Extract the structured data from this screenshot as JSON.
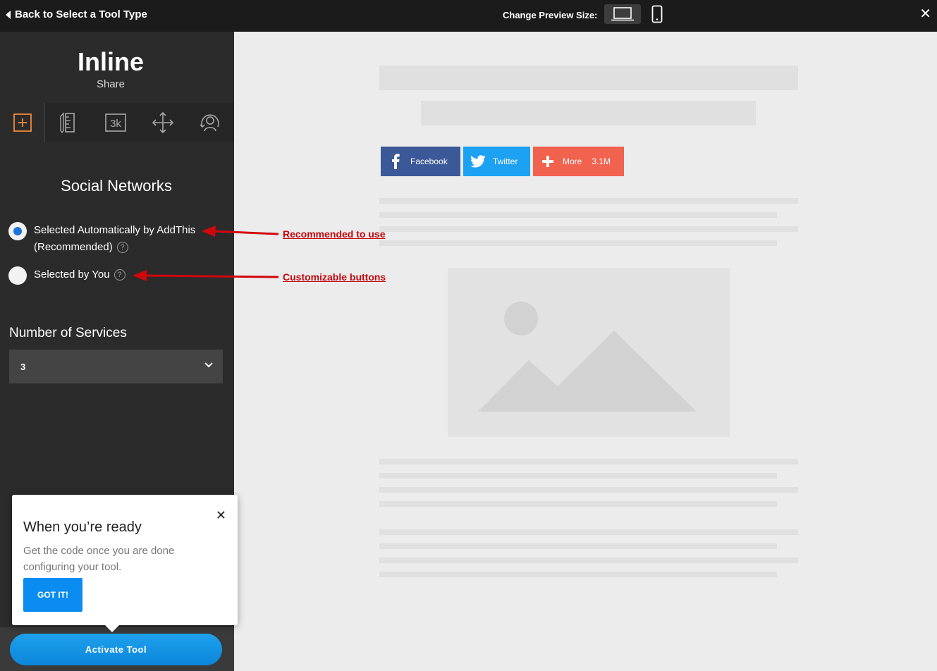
{
  "topbar": {
    "back_label": "Back to Select a Tool Type",
    "preview_label": "Change Preview Size:",
    "close": "✕"
  },
  "sidebar": {
    "title": "Inline",
    "subtitle": "Share",
    "tabs": [
      {
        "name": "add",
        "label": "+"
      },
      {
        "name": "ruler"
      },
      {
        "name": "counts",
        "label": "3k"
      },
      {
        "name": "position"
      },
      {
        "name": "targeting"
      }
    ],
    "section_title": "Social Networks",
    "options": [
      {
        "label_line1": "Selected Automatically by AddThis",
        "label_line2": "(Recommended)",
        "checked": true
      },
      {
        "label_line1": "Selected by You",
        "checked": false
      }
    ],
    "help_glyph": "?",
    "services_label": "Number of Services",
    "services_value": "3",
    "activate_label": "Activate Tool"
  },
  "popup": {
    "close": "✕",
    "title": "When you’re ready",
    "text": "Get the code once you are done configuring your tool.",
    "button": "GOT IT!"
  },
  "preview": {
    "buttons": [
      {
        "label": "Facebook",
        "color": "#3b5998"
      },
      {
        "label": "Twitter",
        "color": "#1da1f2"
      },
      {
        "label": "More",
        "count": "3.1M",
        "color": "#f1624f"
      }
    ]
  },
  "annotations": {
    "recommended": "Recommended to use",
    "customizable": "Customizable buttons"
  },
  "colors": {
    "accent": "#0a8cf0",
    "annotation": "#c4060c",
    "tab_active": "#f0883a"
  }
}
